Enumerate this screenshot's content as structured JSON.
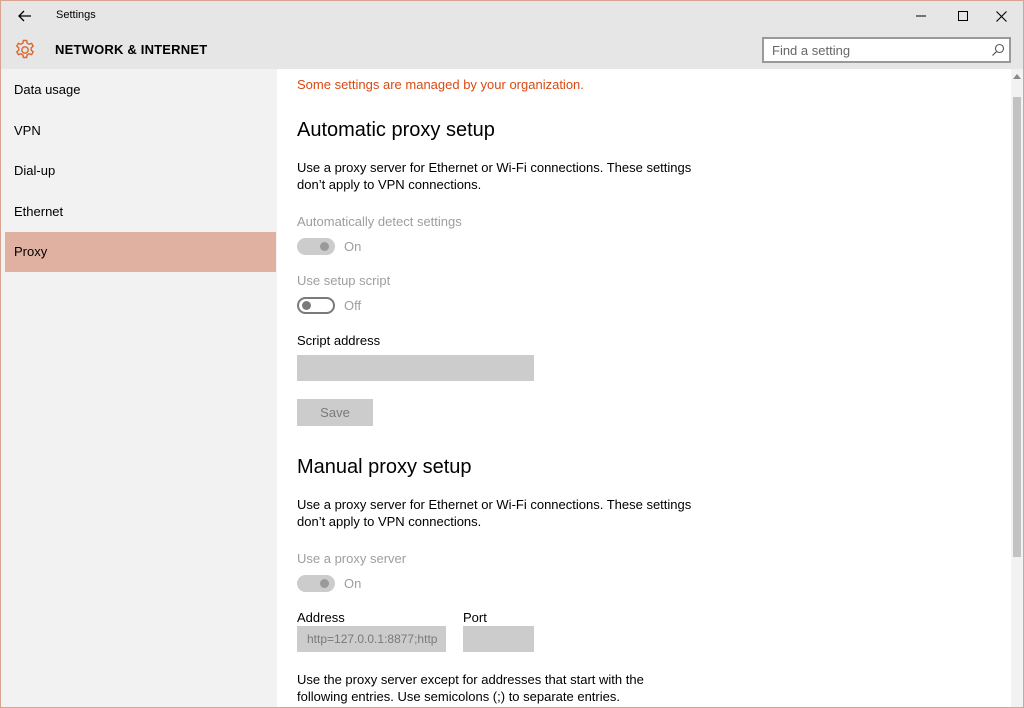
{
  "window": {
    "title": "Settings"
  },
  "header": {
    "title": "NETWORK & INTERNET",
    "search_placeholder": "Find a setting"
  },
  "sidebar": {
    "items": [
      {
        "label": "Data usage",
        "active": false
      },
      {
        "label": "VPN",
        "active": false
      },
      {
        "label": "Dial-up",
        "active": false
      },
      {
        "label": "Ethernet",
        "active": false
      },
      {
        "label": "Proxy",
        "active": true
      }
    ]
  },
  "content": {
    "org_note": "Some settings are managed by your organization.",
    "auto": {
      "heading": "Automatic proxy setup",
      "desc_line1": "Use a proxy server for Ethernet or Wi-Fi connections. These settings",
      "desc_line2": "don’t apply to VPN connections.",
      "detect_label": "Automatically detect settings",
      "detect_state": "On",
      "script_label": "Use setup script",
      "script_state": "Off",
      "address_label": "Script address",
      "address_value": "",
      "save_label": "Save"
    },
    "manual": {
      "heading": "Manual proxy setup",
      "desc_line1": "Use a proxy server for Ethernet or Wi-Fi connections. These settings",
      "desc_line2": "don’t apply to VPN connections.",
      "use_label": "Use a proxy server",
      "use_state": "On",
      "address_label": "Address",
      "address_value": "http=127.0.0.1:8877;http",
      "port_label": "Port",
      "port_value": "",
      "except_line1": "Use the proxy server except for addresses that start with the",
      "except_line2": "following entries. Use semicolons (;) to separate entries."
    }
  },
  "colors": {
    "accent": "#d84a14",
    "active_nav": "#e0b1a1",
    "gear": "#d9662f"
  }
}
